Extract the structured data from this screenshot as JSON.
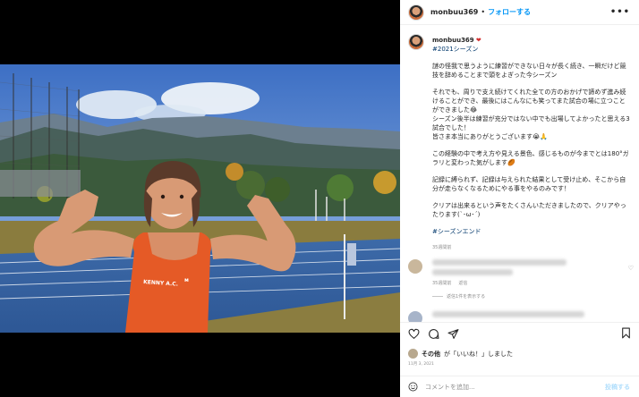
{
  "post": {
    "username": "monbuu369",
    "follow_label": "フォローする",
    "separator": "•",
    "more_label": "•••"
  },
  "caption": {
    "username": "monbuu369",
    "hashtag": "#2021シーズン",
    "paragraphs": [
      "謎の怪我で思うように練習ができない日々が長く続き、一瞬だけど競技を辞めることまで頭をよぎった今シーズン",
      "それでも、周りで支え続けてくれた全ての方のおかげで諦めず進み続けることができ、最後にはこんなにも笑ってまた試合の場に立つことができました😂\nシーズン後半は練習が充分ではない中でも出場してよかったと思える3試合でした！\n皆さま本当にありがとうございます😭🙏",
      "この経験の中で考え方や見える景色、感じるものが今までとは180°ガラリと変わった気がします🏉",
      "記録に縛られず、記録は与えられた結果として受け止め、そこから自分が走らなくなるためにやる事をやるのみです！",
      "クリアは出来るという声をたくさんいただきましたので、クリアやったります(`･ω･´)"
    ],
    "end_tag": "#シーズンエンド",
    "time_ago": "35週間前"
  },
  "comments": [
    {
      "time_ago": "35週間前",
      "reply_label": "返信"
    },
    {
      "view_replies": "返信1件を表示する"
    }
  ],
  "likes": {
    "prefix": "その他",
    "text": "が「いいね！」しました"
  },
  "date": "11月 3, 2021",
  "comment_box": {
    "placeholder": "コメントを追加...",
    "post_label": "投稿する"
  },
  "colors": {
    "link": "#0095f6",
    "hashtag": "#00376b",
    "muted": "#8e8e8e"
  },
  "icons": [
    "heart-icon",
    "comment-icon",
    "share-icon",
    "bookmark-icon",
    "emoji-icon"
  ]
}
